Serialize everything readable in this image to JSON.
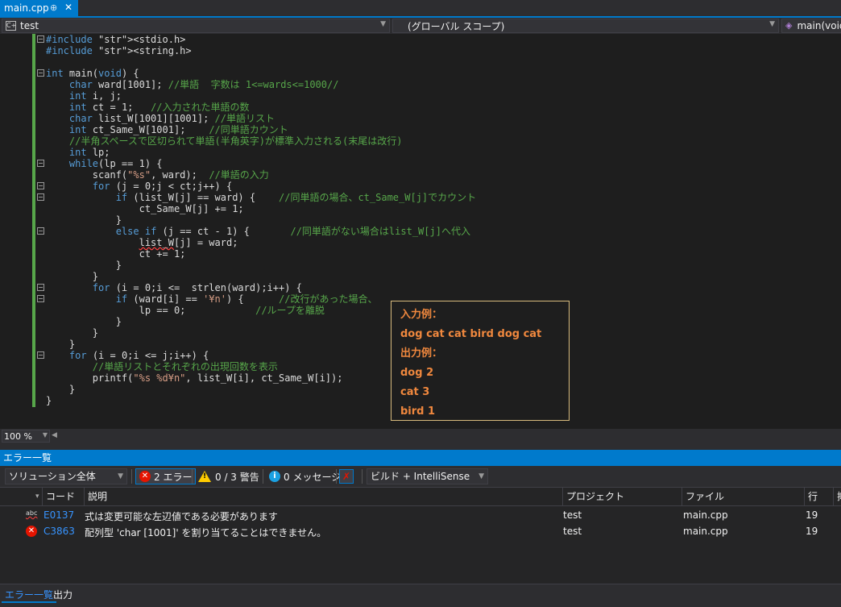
{
  "tab": {
    "filename": "main.cpp",
    "pin": "⊕",
    "close": "✕"
  },
  "navbar": {
    "project": "test",
    "scope": "(グローバル スコープ)",
    "member": "main(void)"
  },
  "code_lines": [
    "#include <stdio.h>",
    "#include <string.h>",
    "",
    "int main(void) {",
    "    char ward[1001]; //単語  字数は 1<=wards<=1000//",
    "    int i, j;",
    "    int ct = 1;   //入力された単語の数",
    "    char list_W[1001][1001]; //単語リスト",
    "    int ct_Same_W[1001];    //同単語カウント",
    "    //半角スペースで区切られて単語(半角英字)が標準入力される(末尾は改行)",
    "    int lp;",
    "    while(lp == 1) {",
    "        scanf(\"%s\", ward);  //単語の入力",
    "        for (j = 0;j < ct;j++) {",
    "            if (list_W[j] == ward) {    //同単語の場合、ct_Same_W[j]でカウント",
    "                ct_Same_W[j] += 1;",
    "            }",
    "            else if (j == ct - 1) {       //同単語がない場合はlist_W[j]へ代入",
    "                list_W[j] = ward;",
    "                ct += 1;",
    "            }",
    "        }",
    "        for (i = 0;i <=  strlen(ward);i++) {",
    "            if (ward[i] == '¥n') {      //改行があった場合、",
    "                lp == 0;            //ループを離脱",
    "            }",
    "        }",
    "    }",
    "    for (i = 0;i <= j;i++) {",
    "        //単語リストとそれぞれの出現回数を表示",
    "        printf(\"%s %d¥n\", list_W[i], ct_Same_W[i]);",
    "    }",
    "}"
  ],
  "sample": {
    "input_label": "入力例：",
    "input_value": "dog cat cat bird dog cat",
    "output_label": "出力例：",
    "outputs": [
      "dog 2",
      "cat 3",
      "bird 1"
    ]
  },
  "zoom": "100 %",
  "error_list": {
    "title": "エラー一覧",
    "scope": "ソリューション全体",
    "errors_btn": "2 エラー",
    "warnings_btn": "0 / 3 警告",
    "messages_btn": "0 メッセージ",
    "build": "ビルド + IntelliSense",
    "columns": {
      "code": "コード",
      "desc": "説明",
      "project": "プロジェクト",
      "file": "ファイル",
      "line": "行",
      "extra": "抑"
    },
    "rows": [
      {
        "icon": "abc",
        "code": "E0137",
        "desc": "式は変更可能な左辺値である必要があります",
        "project": "test",
        "file": "main.cpp",
        "line": "19"
      },
      {
        "icon": "✕",
        "code": "C3863",
        "desc": "配列型 'char [1001]' を割り当てることはできません。",
        "project": "test",
        "file": "main.cpp",
        "line": "19"
      }
    ]
  },
  "bottom_tabs": [
    "エラー一覧",
    "出力"
  ]
}
